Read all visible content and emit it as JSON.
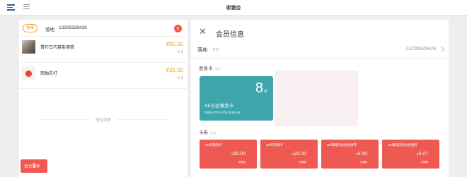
{
  "topbar": {
    "title": "收银台"
  },
  "customer": {
    "tag": "挂单",
    "name": "落地",
    "phone": "13205929426"
  },
  "cart": {
    "items": [
      {
        "name": "青柠白巧慕斯蛋糕",
        "price": "¥00.00",
        "qty": "x 1"
      },
      {
        "name": "西柚苏打",
        "price": "¥25.00",
        "qty": "x 1"
      }
    ],
    "divider": "清空列表"
  },
  "total": {
    "prefix": "合计",
    "count": "8",
    "suffix": "件"
  },
  "panel": {
    "title": "会员信息"
  },
  "member": {
    "name": "落地",
    "sub": "普通",
    "phone": "13205929426"
  },
  "member_card_section": {
    "title": "会员卡",
    "count": "(38)"
  },
  "card": {
    "discount": "8",
    "discount_unit": "折",
    "name": "SK万达尊贵卡",
    "number": "2300 4730 9701 8291 94"
  },
  "coupon_section": {
    "title": "卡券",
    "count": "(43)"
  },
  "coupons": [
    {
      "name": "SK阿斯顿卡",
      "value": "50.00",
      "sub": "无限制"
    },
    {
      "name": "SK阿斯顿卡",
      "value": "20.00",
      "sub": "无限制"
    },
    {
      "name": "SK咖啡皮拉拉优惠券",
      "value": "4.50",
      "sub": "无限制"
    },
    {
      "name": "SK咖啡皮拉拉优惠券",
      "value": "3.07",
      "sub": "无限制"
    }
  ],
  "currency": "¥",
  "colors": {
    "accent": "#ee5a52",
    "card": "#3ea5ad",
    "price": "#f0a020",
    "tag": "#f08a20"
  }
}
